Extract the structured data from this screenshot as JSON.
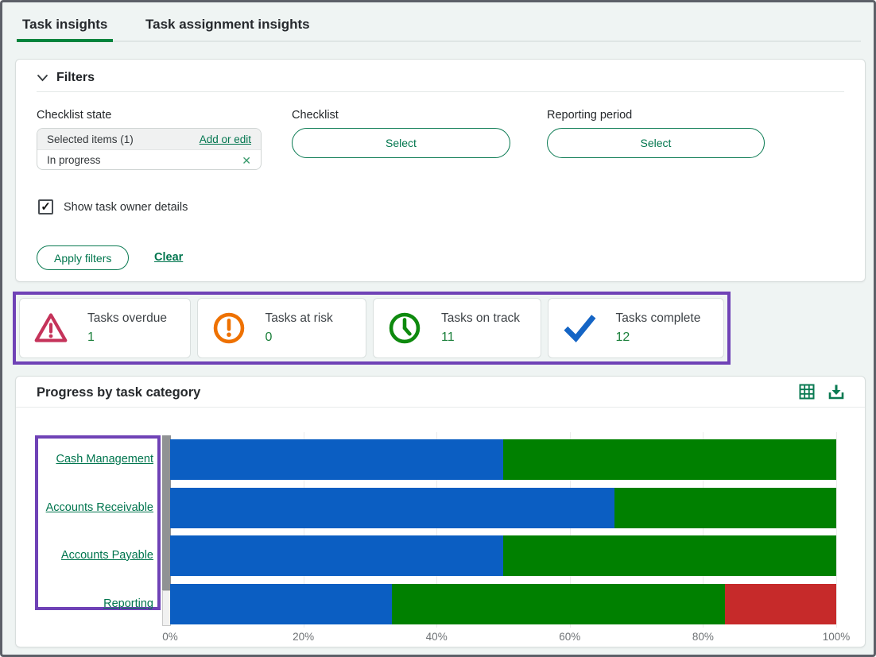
{
  "tabs": [
    {
      "label": "Task insights",
      "active": true
    },
    {
      "label": "Task assignment insights",
      "active": false
    }
  ],
  "filters": {
    "title": "Filters",
    "checklist_state": {
      "label": "Checklist state",
      "selected_summary": "Selected items (1)",
      "add_or_edit_label": "Add or edit",
      "selected_item": "In progress",
      "remove_glyph": "✕"
    },
    "checklist": {
      "label": "Checklist",
      "button_label": "Select"
    },
    "reporting_period": {
      "label": "Reporting period",
      "button_label": "Select"
    },
    "show_task_owner": {
      "label": "Show task owner details",
      "checked": true,
      "check_glyph": "✓"
    },
    "apply_label": "Apply filters",
    "clear_label": "Clear"
  },
  "kpis": [
    {
      "label": "Tasks overdue",
      "value": "1",
      "icon": "warning-triangle-icon",
      "icon_color": "#c5335a"
    },
    {
      "label": "Tasks at risk",
      "value": "0",
      "icon": "alert-circle-icon",
      "icon_color": "#ee7101"
    },
    {
      "label": "Tasks on track",
      "value": "11",
      "icon": "clock-icon",
      "icon_color": "#0e8a0e"
    },
    {
      "label": "Tasks complete",
      "value": "12",
      "icon": "checkmark-icon",
      "icon_color": "#1565c5"
    }
  ],
  "chart": {
    "title": "Progress by task category",
    "table_view_icon": "table-view-icon",
    "download_icon": "download-icon"
  },
  "chart_data": {
    "type": "bar",
    "orientation": "horizontal",
    "stacked": true,
    "title": "Progress by task category",
    "categories": [
      "Cash Management",
      "Accounts Receivable",
      "Accounts Payable",
      "Reporting"
    ],
    "series": [
      {
        "name": "complete",
        "color": "#0b5ec2",
        "values": [
          50.0,
          66.7,
          50.0,
          33.3
        ]
      },
      {
        "name": "on_track",
        "color": "#008000",
        "values": [
          50.0,
          33.3,
          50.0,
          50.0
        ]
      },
      {
        "name": "overdue",
        "color": "#c62a2a",
        "values": [
          0.0,
          0.0,
          0.0,
          16.7
        ]
      }
    ],
    "x_ticks": [
      "0%",
      "20%",
      "40%",
      "60%",
      "80%",
      "100%"
    ],
    "xlim": [
      0,
      100
    ],
    "grid": true,
    "legend": false
  },
  "colors": {
    "accent_green": "#00764d",
    "tab_underline_green": "#00843d",
    "highlight_purple": "#6f42b6",
    "kpi_value_green": "#1a7f3a",
    "background": "#eff4f3"
  }
}
